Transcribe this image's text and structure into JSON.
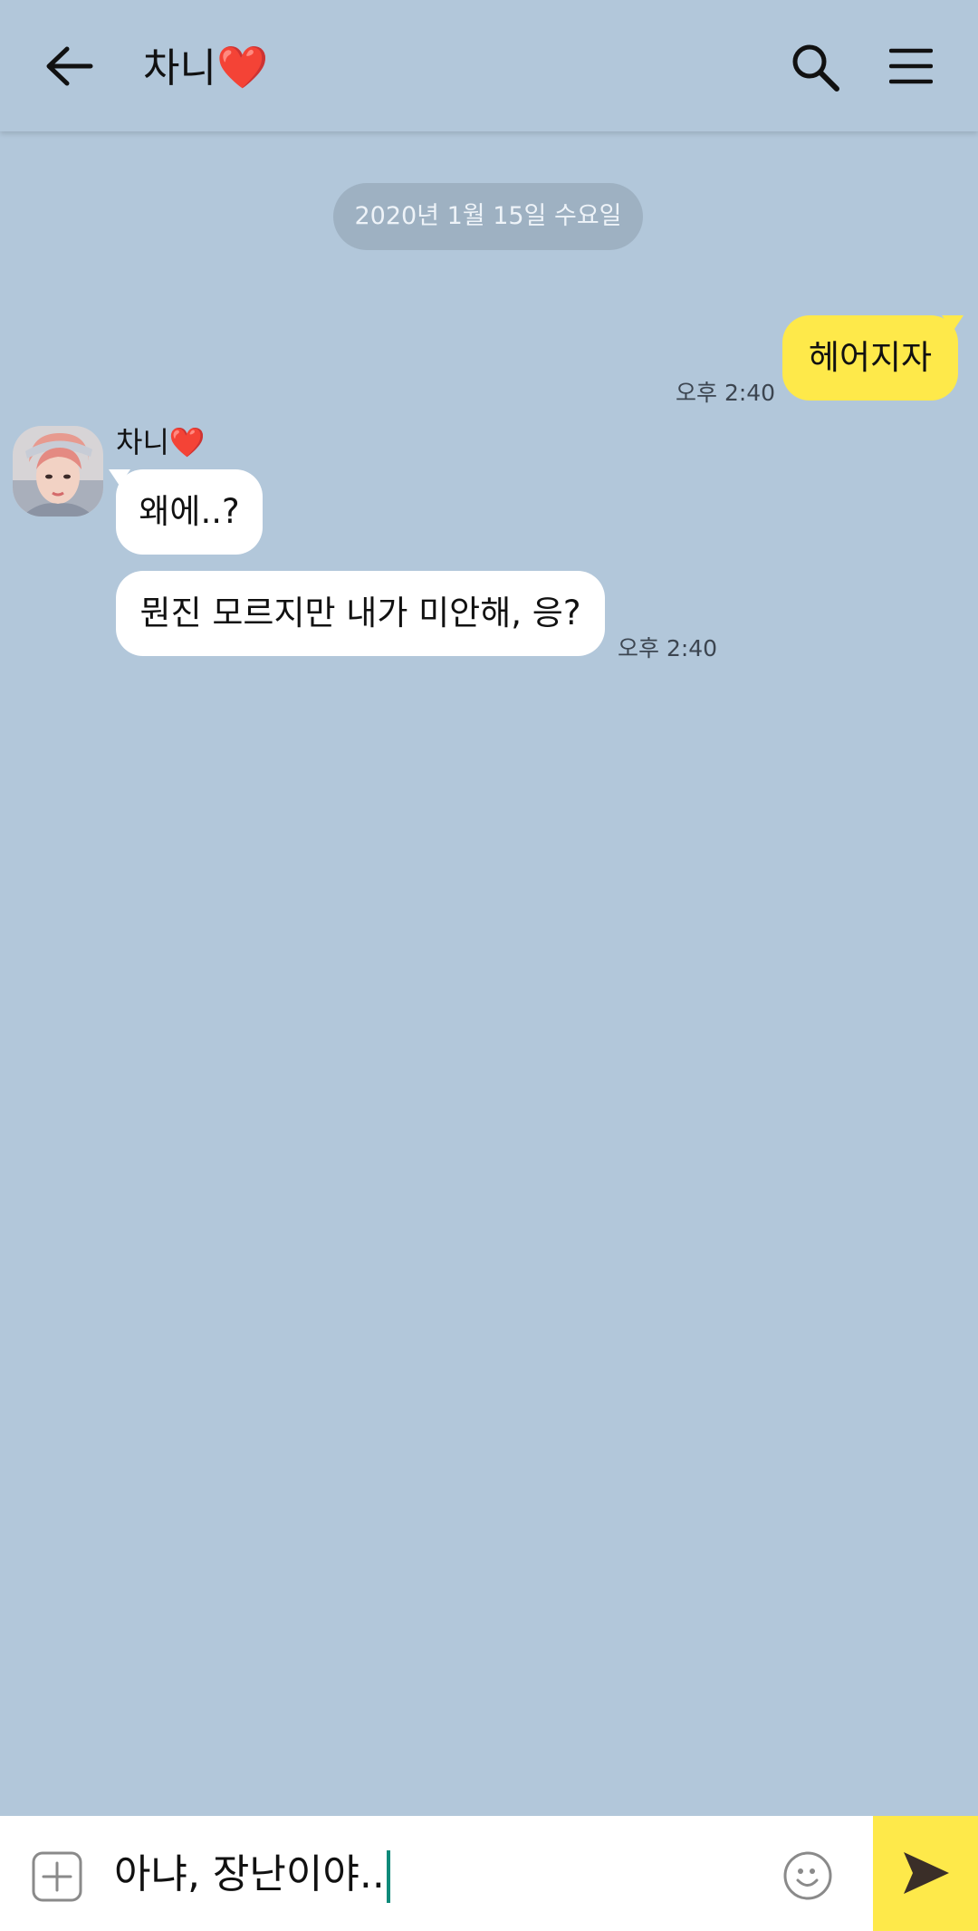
{
  "colors": {
    "background": "#b2c7da",
    "my_bubble": "#fee94a",
    "their_bubble": "#ffffff",
    "send_button": "#fee94a",
    "caret": "#0f8a7a"
  },
  "header": {
    "title": "차니",
    "title_emoji": "❤️",
    "back_icon": "arrow-left-icon",
    "search_icon": "search-icon",
    "menu_icon": "hamburger-menu-icon"
  },
  "chat": {
    "date_label": "2020년 1월 15일 수요일",
    "messages": [
      {
        "from": "me",
        "text": "헤어지자",
        "time": "오후 2:40"
      },
      {
        "from": "them",
        "sender": "차니",
        "sender_emoji": "❤️",
        "text": "왜에..?"
      },
      {
        "from": "them",
        "text": "뭔진 모르지만 내가 미안해, 응?",
        "time": "오후 2:40"
      }
    ]
  },
  "composer": {
    "input_value": "아냐, 장난이야..",
    "add_icon": "plus-square-icon",
    "emoji_icon": "smiley-icon",
    "send_icon": "send-arrow-icon"
  }
}
